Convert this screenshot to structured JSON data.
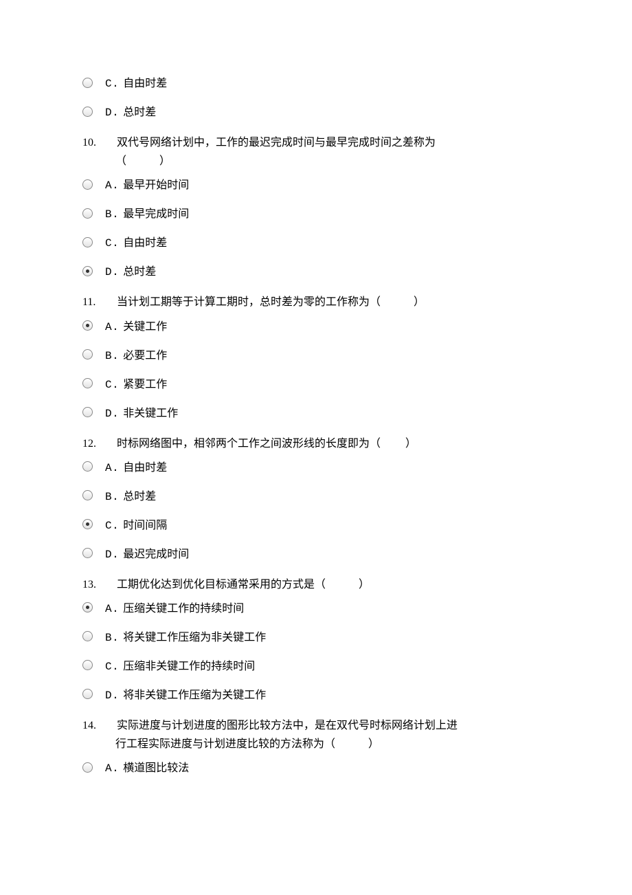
{
  "orphan_options": [
    {
      "letter": "C.",
      "text": "自由时差",
      "selected": false
    },
    {
      "letter": "D.",
      "text": "总时差",
      "selected": false
    }
  ],
  "questions": [
    {
      "num": "10.",
      "text": "双代号网络计划中，工作的最迟完成时间与最早完成时间之差称为",
      "text2": "（　　　）",
      "options": [
        {
          "letter": "A.",
          "text": "最早开始时间",
          "selected": false
        },
        {
          "letter": "B.",
          "text": "最早完成时间",
          "selected": false
        },
        {
          "letter": "C.",
          "text": "自由时差",
          "selected": false
        },
        {
          "letter": "D.",
          "text": "总时差",
          "selected": true
        }
      ]
    },
    {
      "num": "11.",
      "text": "当计划工期等于计算工期时，总时差为零的工作称为（　　　）",
      "options": [
        {
          "letter": "A.",
          "text": "关键工作",
          "selected": true
        },
        {
          "letter": "B.",
          "text": "必要工作",
          "selected": false
        },
        {
          "letter": "C.",
          "text": "紧要工作",
          "selected": false
        },
        {
          "letter": "D.",
          "text": "非关键工作",
          "selected": false
        }
      ]
    },
    {
      "num": "12.",
      "text": "时标网络图中，相邻两个工作之间波形线的长度即为（　　 ）",
      "options": [
        {
          "letter": "A.",
          "text": "自由时差",
          "selected": false
        },
        {
          "letter": "B.",
          "text": "总时差",
          "selected": false
        },
        {
          "letter": "C.",
          "text": "时间间隔",
          "selected": true
        },
        {
          "letter": "D.",
          "text": "最迟完成时间",
          "selected": false
        }
      ]
    },
    {
      "num": "13.",
      "text": "工期优化达到优化目标通常采用的方式是（　　　）",
      "options": [
        {
          "letter": "A.",
          "text": "压缩关键工作的持续时间",
          "selected": true
        },
        {
          "letter": "B.",
          "text": "将关键工作压缩为非关键工作",
          "selected": false
        },
        {
          "letter": "C.",
          "text": "压缩非关键工作的持续时间",
          "selected": false
        },
        {
          "letter": "D.",
          "text": "将非关键工作压缩为关键工作",
          "selected": false
        }
      ]
    },
    {
      "num": "14.",
      "text": "实际进度与计划进度的图形比较方法中，是在双代号时标网络计划上进",
      "text2": "行工程实际进度与计划进度比较的方法称为（　　　）",
      "options": [
        {
          "letter": "A.",
          "text": "横道图比较法",
          "selected": false
        }
      ]
    }
  ]
}
